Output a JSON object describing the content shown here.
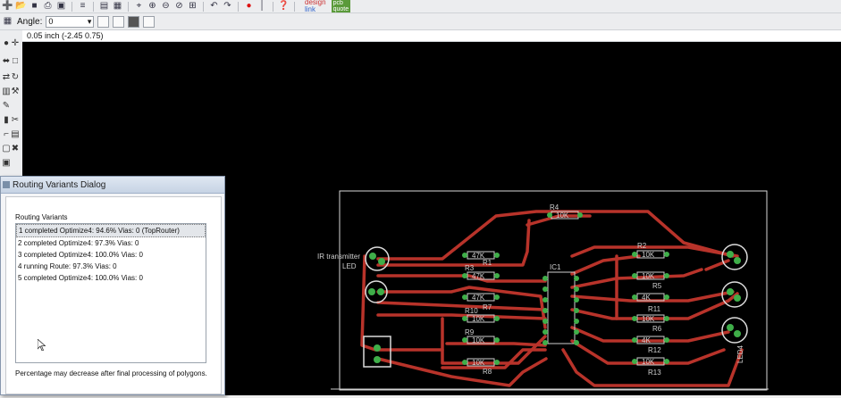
{
  "toolbar": {
    "icons": [
      "new-icon",
      "open-icon",
      "save-icon",
      "print-icon",
      "cam-icon",
      "layers-icon",
      "script-icon",
      "zoom-fit-icon",
      "zoom-in-icon",
      "zoom-out-icon",
      "zoom-prev-icon",
      "zoom-select-icon",
      "undo-icon",
      "redo-icon",
      "stop-icon",
      "go-icon",
      "help-icon"
    ],
    "brand1": "design",
    "brand2": "link",
    "brand3": "pcb",
    "brand4": "quote"
  },
  "param_bar": {
    "angle_label": "Angle:",
    "angle_value": "0"
  },
  "coord": {
    "text": "0.05 inch (-2.45 0.75)"
  },
  "dialog": {
    "title": "Routing Variants Dialog",
    "section_label": "Routing Variants",
    "rows": [
      "1 completed Optimize4:  94.6%  Vias: 0 (TopRouter)",
      "2 completed Optimize4:  97.3%  Vias: 0",
      "3 completed Optimize4:  100.0%  Vias: 0",
      "4 running Route:  97.3%  Vias: 0",
      "5 completed Optimize4:  100.0%  Vias: 0"
    ],
    "note": "Percentage may decrease after final processing of polygons."
  },
  "board": {
    "labels": {
      "ir": "IR transmitter",
      "led": "LED",
      "r4": "R4",
      "r4v": "10K",
      "r1": "R1",
      "r1v": "47K",
      "r3": "R3",
      "r3v": "47K",
      "r7": "R7",
      "r7v": "47K",
      "r10": "R10",
      "r10v": "10K",
      "r9": "R9",
      "r9v": "10K",
      "r8b": "R8",
      "r8bv": "10K",
      "ic1": "IC1",
      "r2": "R2",
      "r2v": "10K",
      "r5": "R5",
      "r5v": "10K",
      "r11": "R11",
      "r11v": "4K",
      "r6": "R6",
      "r6v": "10K",
      "r12": "R12",
      "r12v": "4K",
      "r13": "R13",
      "r13v": "10K",
      "led4": "LED4"
    }
  }
}
